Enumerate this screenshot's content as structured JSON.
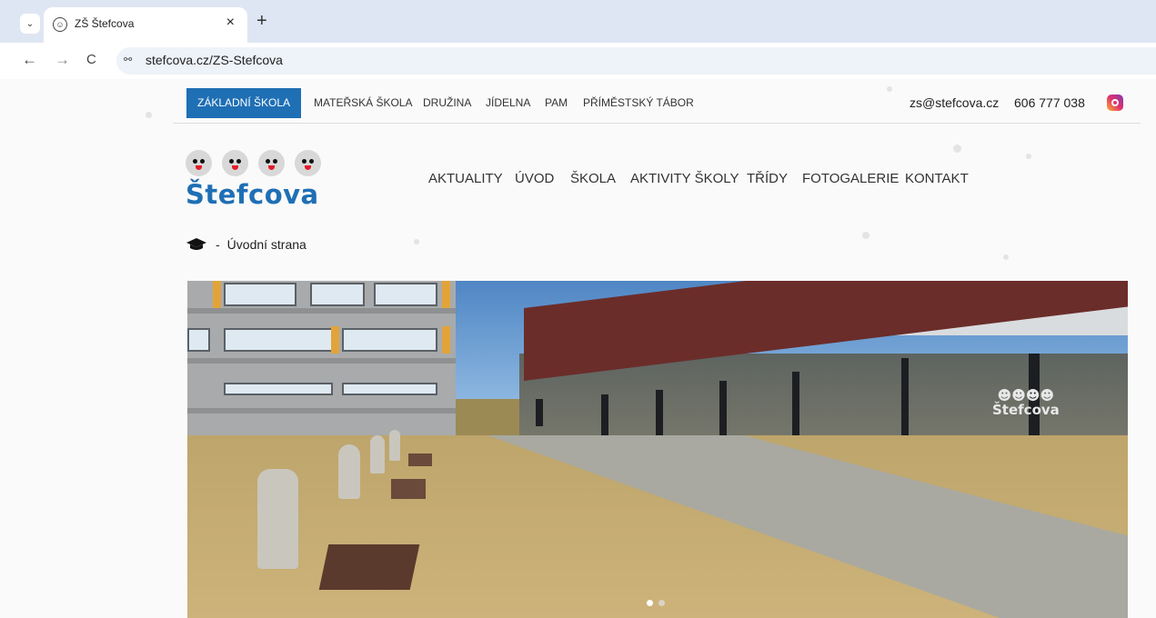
{
  "browser": {
    "tab": {
      "title": "ZŠ Štefcova",
      "close": "×"
    },
    "new_tab": "+",
    "tab_menu": "⌄",
    "back": "←",
    "forward": "→",
    "reload": "C",
    "site_info": "⚯",
    "url": "stefcova.cz/ZS-Stefcova"
  },
  "topbar": {
    "active": "ZÁKLADNÍ ŠKOLA",
    "links": [
      "MATEŘSKÁ ŠKOLA",
      "DRUŽINA",
      "JÍDELNA",
      "PAM",
      "PŘÍMĚSTSKÝ TÁBOR"
    ],
    "email": "zs@stefcova.cz",
    "phone": "606 777 038",
    "social_icon": "instagram-icon"
  },
  "logo": {
    "text": "Štefcova",
    "faces": 4
  },
  "main_nav": [
    "AKTUALITY",
    "ÚVOD",
    "ŠKOLA",
    "AKTIVITY ŠKOLY",
    "TŘÍDY",
    "FOTOGALERIE",
    "KONTAKT"
  ],
  "breadcrumb": {
    "icon": "graduation-cap-icon",
    "separator": "-",
    "label": "Úvodní strana"
  },
  "hero": {
    "logo_faces": "☻☻☻☻",
    "logo_text": "Štefcova",
    "slides": 2,
    "active_slide": 1
  },
  "colors": {
    "accent": "#1f6fb5",
    "logo_mouth": "#e21b2b"
  }
}
